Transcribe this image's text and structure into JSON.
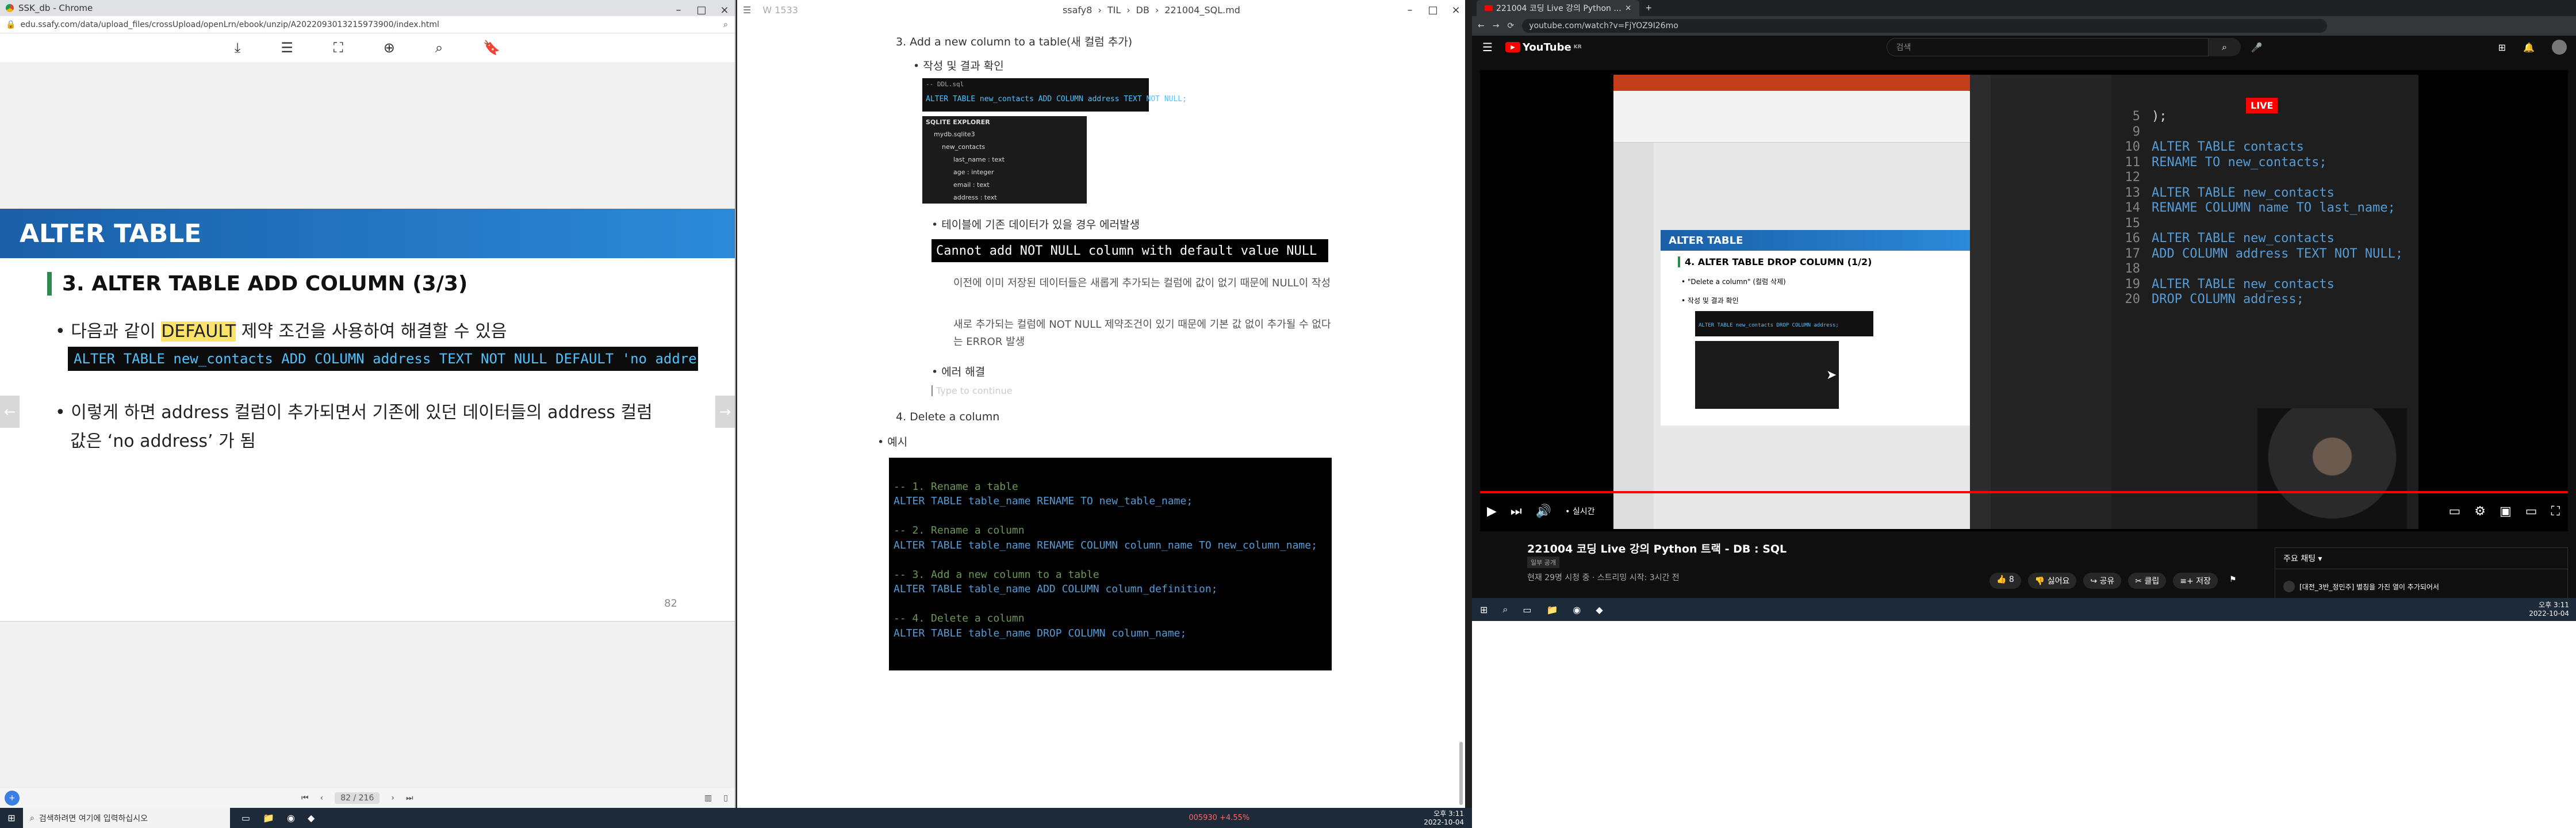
{
  "chrome_left": {
    "title": "SSK_db - Chrome",
    "url": "edu.ssafy.com/data/upload_files/crossUpload/openLrn/ebook/unzip/A2022093013215973900/index.html"
  },
  "slide": {
    "header": "ALTER TABLE",
    "title": "3. ALTER TABLE ADD COLUMN (3/3)",
    "bullet1_pre": "다음과 같이 ",
    "bullet1_hl": "DEFAULT",
    "bullet1_post": " 제약 조건을 사용하여 해결할 수 있음",
    "code": "ALTER TABLE new_contacts ADD COLUMN address TEXT NOT NULL DEFAULT 'no address';",
    "bullet2_l1": "이렇게 하면 address 컬럼이 추가되면서 기존에 있던 데이터들의 address 컬럼",
    "bullet2_l2": "값은 ‘no address’ 가 됨",
    "page_num": "82",
    "pager": "82 / 216"
  },
  "md": {
    "win_title": "W 1533",
    "breadcrumb": [
      "ssafy8",
      "TIL",
      "DB",
      "221004_SQL.md"
    ],
    "h3": "3. Add a new column to a table(새 컬럼 추가)",
    "b_result": "작성 및 결과 확인",
    "fig1_head": "-- DDL.sql",
    "fig1_code": "ALTER TABLE new_contacts ADD COLUMN address TEXT NOT NULL;",
    "explorer_title": "SQLITE EXPLORER",
    "explorer_items": [
      "mydb.sqlite3",
      "new_contacts",
      "last_name : text",
      "age : integer",
      "email : text",
      "address : text"
    ],
    "b_error": "테이블에 기존 데이터가 있을 경우 에러발생",
    "error_box": "Cannot add NOT NULL column with default value NULL",
    "sub1": "이전에 이미 저장된 데이터들은 새롭게 추가되는 컬럼에 값이 없기 때문에 NULL이 작성",
    "sub2": "새로 추가되는 컬럼에 NOT NULL 제약조건이 있기 때문에 기본 값 없이 추가될 수 없다는 ERROR 발생",
    "b_fix": "에러 해결",
    "placeholder": "Type to continue",
    "h4": "4. Delete a column",
    "example": "예시",
    "code_lines": [
      "-- 1. Rename a table",
      "ALTER TABLE table_name RENAME TO new_table_name;",
      "",
      "-- 2. Rename a column",
      "ALTER TABLE table_name RENAME COLUMN column_name TO new_column_name;",
      "",
      "-- 3. Add a new column to a table",
      "ALTER TABLE table_name ADD COLUMN column_definition;",
      "",
      "-- 4. Delete a column",
      "ALTER TABLE table_name DROP COLUMN column_name;"
    ]
  },
  "yt": {
    "tab": "221004 코딩 Live 강의 Python ...",
    "url": "youtube.com/watch?v=FjYOZ9I26mo",
    "search_placeholder": "검색",
    "logo": "YouTube",
    "logo_sup": "KR",
    "video_title": "221004 코딩 Live 강의 Python 트랙 - DB : SQL",
    "unlisted": "일부 공개",
    "meta": "현재 29명 시청 중 · 스트리밍 시작: 3시간 전",
    "likes": "8",
    "dislike": "싫어요",
    "share": "공유",
    "clip": "클립",
    "save": "저장",
    "live_badge": "LIVE",
    "live_label": "• 실시간",
    "chat_title": "주요 채팅",
    "chat_msg": "[대전_3반_정민주] 별칭을 가진 열이 추가되어서",
    "ppt_header": "ALTER TABLE",
    "ppt_title": "4. ALTER TABLE DROP COLUMN (1/2)",
    "ppt_b1": "\"Delete a column\" (컬럼 삭제)",
    "ppt_b2": "작성 및 결과 확인",
    "ppt_code": "ALTER TABLE new_contacts DROP COLUMN address;",
    "vs_lines": [
      {
        "n": "5",
        "t": ");"
      },
      {
        "n": "9",
        "t": ""
      },
      {
        "n": "10",
        "t": "ALTER TABLE contacts"
      },
      {
        "n": "11",
        "t": "RENAME TO new_contacts;"
      },
      {
        "n": "12",
        "t": ""
      },
      {
        "n": "13",
        "t": "ALTER TABLE new_contacts"
      },
      {
        "n": "14",
        "t": "RENAME COLUMN name TO last_name;"
      },
      {
        "n": "15",
        "t": ""
      },
      {
        "n": "16",
        "t": "ALTER TABLE new_contacts"
      },
      {
        "n": "17",
        "t": "ADD COLUMN address TEXT NOT NULL;"
      },
      {
        "n": "18",
        "t": ""
      },
      {
        "n": "19",
        "t": "ALTER TABLE new_contacts"
      },
      {
        "n": "20",
        "t": "DROP COLUMN address;"
      }
    ],
    "clock_time": "오후 3:11",
    "clock_date": "2022-10-04"
  },
  "taskbar": {
    "search": "검색하려면 여기에 입력하십시오",
    "stock": "005930 +4.55%",
    "time": "오후 3:11",
    "date": "2022-10-04"
  },
  "colors": {
    "slide_blue": "#1f78c8",
    "accent_green": "#2d8a4e",
    "yt_red": "#ff0000"
  }
}
